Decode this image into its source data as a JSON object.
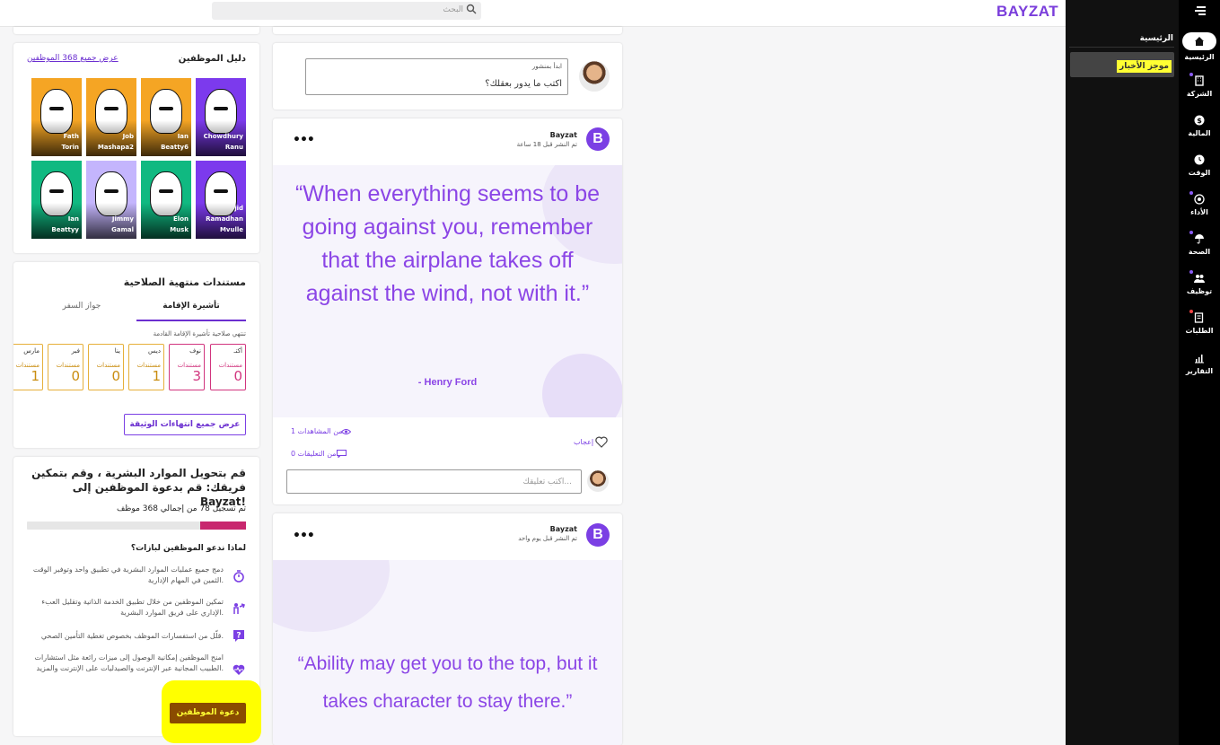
{
  "app": {
    "logo": "BAYZAT",
    "search_placeholder": "البحث"
  },
  "rail": {
    "items": [
      {
        "label": "الرئيسية",
        "icon": "home-icon",
        "active": true
      },
      {
        "label": "الشركة",
        "icon": "building-icon"
      },
      {
        "label": "المالية",
        "icon": "dollar-icon"
      },
      {
        "label": "الوقت",
        "icon": "clock-icon"
      },
      {
        "label": "الأداء",
        "icon": "target-icon"
      },
      {
        "label": "الصحة",
        "icon": "umbrella-icon"
      },
      {
        "label": "توظيف",
        "icon": "people-icon"
      },
      {
        "label": "الطلبات",
        "icon": "requests-icon"
      },
      {
        "label": "التقارير",
        "icon": "chart-icon"
      }
    ]
  },
  "subnav": {
    "title": "الرئيسية",
    "item": "موجز الأخبار"
  },
  "composer": {
    "hint": "ابدأ بمنشور",
    "placeholder": "اكتب ما يدور بعقلك؟"
  },
  "posts": [
    {
      "author": "Bayzat",
      "time": "تم النشر قبل 18 ساعة",
      "quote": "“When everything seems to be going against you, remember that the airplane takes off against the wind, not with it.”",
      "quote_author": "- Henry Ford",
      "like_label": "إعجاب",
      "views": "1 من المشاهدات",
      "comments": "0 من التعليقات",
      "comment_placeholder": "اكتب تعليقك..."
    },
    {
      "author": "Bayzat",
      "time": "تم النشر قبل يوم واحد",
      "quote": "“Ability may get you to the top, but it takes character to stay there.”"
    }
  ],
  "directory": {
    "title": "دليل الموظفين",
    "link": "عرض جميع 368 الموظفين",
    "employees": [
      {
        "name1": "Chowdhury",
        "name2": "Ranu",
        "color": "#7c3aed"
      },
      {
        "name1": "Ian",
        "name2": "Beatty6",
        "color": "#f5a524"
      },
      {
        "name1": "Job",
        "name2": "Mashapa2",
        "color": "#f5a524"
      },
      {
        "name1": "Fath",
        "name2": "Torin",
        "color": "#f5a524"
      },
      {
        "name1": "jid Ramadhan",
        "name2": "Mvulle",
        "color": "#7c3aed"
      },
      {
        "name1": "Elon",
        "name2": "Musk",
        "color": "#10b981"
      },
      {
        "name1": "Jimmy",
        "name2": "Gamal",
        "color": "#c4b5fd"
      },
      {
        "name1": "Ian",
        "name2": "Beattyy",
        "color": "#10b981"
      }
    ]
  },
  "documents": {
    "title": "مستندات منتهية الصلاحية",
    "tabs": [
      "تأشيرة الإقامة",
      "جواز السفر"
    ],
    "hint": "تنتهي صلاحية تأشيرة الإقامة القادمة",
    "unit": "مستندات",
    "months": [
      {
        "month": "أكتـ",
        "value": "0",
        "tone": "pink"
      },
      {
        "month": "نوف",
        "value": "3",
        "tone": "pink"
      },
      {
        "month": "ديس",
        "value": "1",
        "tone": "gold"
      },
      {
        "month": "ينا",
        "value": "0",
        "tone": "gold"
      },
      {
        "month": "فبر",
        "value": "0",
        "tone": "gold"
      },
      {
        "month": "مارس",
        "value": "1",
        "tone": "gold"
      }
    ],
    "button": "عرض جميع انتهاءات الوثيقة"
  },
  "invite": {
    "headline": "قم بتحويل الموارد البشرية ، وقم بتمكين فريقك: قم بدعوة الموظفين إلى Bayzat!",
    "registered": "تم تسجيل 78 من إجمالي 368 موظف",
    "progress": 0.21,
    "why": "لماذا ندعو الموظفين لبازات؟",
    "reasons": [
      "دمج جميع عمليات الموارد البشرية في تطبيق واحد وتوفير الوقت الثمين في المهام الإدارية.",
      "تمكين الموظفين من خلال تطبيق الخدمة الذاتية وتقليل العبء الإداري على فريق الموارد البشرية.",
      "قلّل من استفسارات الموظف بخصوص تغطية التأمين الصحي.",
      "امنح الموظفين إمكانية الوصول إلى ميزات رائعة مثل استشارات الطبيب المجانية عبر الإنترنت والصيدليات على الإنترنت والمزيد."
    ],
    "button": "دعوة الموظفين"
  }
}
